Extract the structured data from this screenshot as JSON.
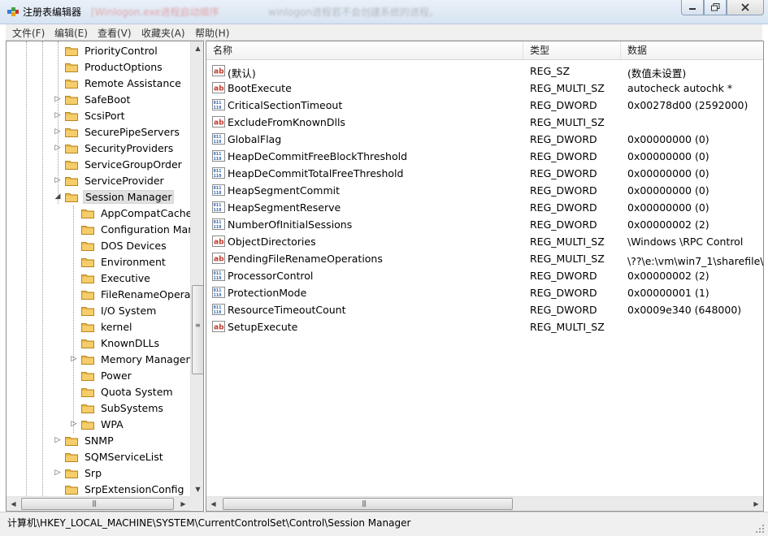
{
  "window": {
    "title": "注册表编辑器",
    "title_obscured": "[Winlogon.exe进程启动顺序",
    "title_obscured_2": "winlogon进程若不会创建系统的进程。",
    "controls": {
      "minimize_icon": "minimize-icon",
      "maximize_icon": "maximize-icon",
      "close_icon": "close-icon"
    }
  },
  "menu": [
    {
      "label": "文件(F)"
    },
    {
      "label": "编辑(E)"
    },
    {
      "label": "查看(V)"
    },
    {
      "label": "收藏夹(A)"
    },
    {
      "label": "帮助(H)"
    }
  ],
  "tree": {
    "items": [
      {
        "label": "PriorityControl",
        "level": 1,
        "expandable": false,
        "selected": false
      },
      {
        "label": "ProductOptions",
        "level": 1,
        "expandable": false,
        "selected": false
      },
      {
        "label": "Remote Assistance",
        "level": 1,
        "expandable": false,
        "selected": false
      },
      {
        "label": "SafeBoot",
        "level": 1,
        "expandable": true,
        "selected": false
      },
      {
        "label": "ScsiPort",
        "level": 1,
        "expandable": true,
        "selected": false
      },
      {
        "label": "SecurePipeServers",
        "level": 1,
        "expandable": true,
        "selected": false
      },
      {
        "label": "SecurityProviders",
        "level": 1,
        "expandable": true,
        "selected": false
      },
      {
        "label": "ServiceGroupOrder",
        "level": 1,
        "expandable": false,
        "selected": false
      },
      {
        "label": "ServiceProvider",
        "level": 1,
        "expandable": true,
        "selected": false
      },
      {
        "label": "Session Manager",
        "level": 1,
        "expandable": true,
        "expanded": true,
        "selected": true
      },
      {
        "label": "AppCompatCache",
        "level": 2,
        "expandable": false,
        "selected": false
      },
      {
        "label": "Configuration Mana",
        "level": 2,
        "expandable": false,
        "selected": false
      },
      {
        "label": "DOS Devices",
        "level": 2,
        "expandable": false,
        "selected": false
      },
      {
        "label": "Environment",
        "level": 2,
        "expandable": false,
        "selected": false
      },
      {
        "label": "Executive",
        "level": 2,
        "expandable": false,
        "selected": false
      },
      {
        "label": "FileRenameOperatio",
        "level": 2,
        "expandable": false,
        "selected": false
      },
      {
        "label": "I/O System",
        "level": 2,
        "expandable": false,
        "selected": false
      },
      {
        "label": "kernel",
        "level": 2,
        "expandable": false,
        "selected": false
      },
      {
        "label": "KnownDLLs",
        "level": 2,
        "expandable": false,
        "selected": false
      },
      {
        "label": "Memory Managem",
        "level": 2,
        "expandable": true,
        "selected": false
      },
      {
        "label": "Power",
        "level": 2,
        "expandable": false,
        "selected": false
      },
      {
        "label": "Quota System",
        "level": 2,
        "expandable": false,
        "selected": false
      },
      {
        "label": "SubSystems",
        "level": 2,
        "expandable": false,
        "selected": false
      },
      {
        "label": "WPA",
        "level": 2,
        "expandable": true,
        "selected": false
      },
      {
        "label": "SNMP",
        "level": 1,
        "expandable": true,
        "selected": false
      },
      {
        "label": "SQMServiceList",
        "level": 1,
        "expandable": false,
        "selected": false
      },
      {
        "label": "Srp",
        "level": 1,
        "expandable": true,
        "selected": false
      },
      {
        "label": "SrpExtensionConfig",
        "level": 1,
        "expandable": false,
        "selected": false
      }
    ]
  },
  "list": {
    "columns": [
      "名称",
      "类型",
      "数据"
    ],
    "rows": [
      {
        "name": "(默认)",
        "type": "REG_SZ",
        "data": "(数值未设置)",
        "icon": "string-value-icon"
      },
      {
        "name": "BootExecute",
        "type": "REG_MULTI_SZ",
        "data": "autocheck autochk *",
        "icon": "string-value-icon"
      },
      {
        "name": "CriticalSectionTimeout",
        "type": "REG_DWORD",
        "data": "0x00278d00 (2592000)",
        "icon": "binary-value-icon"
      },
      {
        "name": "ExcludeFromKnownDlls",
        "type": "REG_MULTI_SZ",
        "data": "",
        "icon": "string-value-icon"
      },
      {
        "name": "GlobalFlag",
        "type": "REG_DWORD",
        "data": "0x00000000 (0)",
        "icon": "binary-value-icon"
      },
      {
        "name": "HeapDeCommitFreeBlockThreshold",
        "type": "REG_DWORD",
        "data": "0x00000000 (0)",
        "icon": "binary-value-icon"
      },
      {
        "name": "HeapDeCommitTotalFreeThreshold",
        "type": "REG_DWORD",
        "data": "0x00000000 (0)",
        "icon": "binary-value-icon"
      },
      {
        "name": "HeapSegmentCommit",
        "type": "REG_DWORD",
        "data": "0x00000000 (0)",
        "icon": "binary-value-icon"
      },
      {
        "name": "HeapSegmentReserve",
        "type": "REG_DWORD",
        "data": "0x00000000 (0)",
        "icon": "binary-value-icon"
      },
      {
        "name": "NumberOfInitialSessions",
        "type": "REG_DWORD",
        "data": "0x00000002 (2)",
        "icon": "binary-value-icon"
      },
      {
        "name": "ObjectDirectories",
        "type": "REG_MULTI_SZ",
        "data": "\\Windows \\RPC Control",
        "icon": "string-value-icon"
      },
      {
        "name": "PendingFileRenameOperations",
        "type": "REG_MULTI_SZ",
        "data": "\\??\\e:\\vm\\win7_1\\sharefile\\新",
        "icon": "string-value-icon"
      },
      {
        "name": "ProcessorControl",
        "type": "REG_DWORD",
        "data": "0x00000002 (2)",
        "icon": "binary-value-icon"
      },
      {
        "name": "ProtectionMode",
        "type": "REG_DWORD",
        "data": "0x00000001 (1)",
        "icon": "binary-value-icon"
      },
      {
        "name": "ResourceTimeoutCount",
        "type": "REG_DWORD",
        "data": "0x0009e340 (648000)",
        "icon": "binary-value-icon"
      },
      {
        "name": "SetupExecute",
        "type": "REG_MULTI_SZ",
        "data": "",
        "icon": "string-value-icon"
      }
    ]
  },
  "status": {
    "path": "计算机\\HKEY_LOCAL_MACHINE\\SYSTEM\\CurrentControlSet\\Control\\Session Manager"
  },
  "colors": {
    "title_bar": "#dbe6f3",
    "folder": "#e8b84a",
    "string_icon": "#c0392b",
    "binary_icon": "#2b5fab"
  }
}
